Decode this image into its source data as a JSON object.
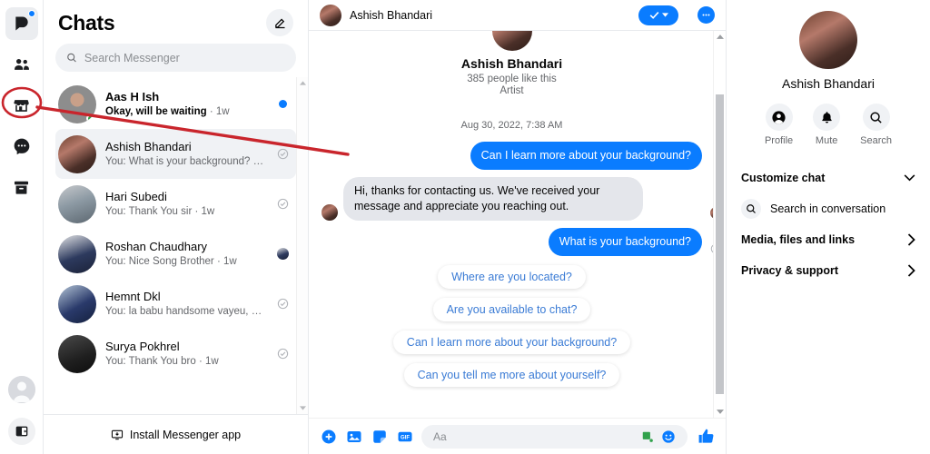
{
  "rail": {
    "items": [
      {
        "name": "facebook-home-icon",
        "label": "Facebook",
        "active": true,
        "badge": true
      },
      {
        "name": "friends-icon",
        "label": "Friends",
        "active": false,
        "badge": false
      },
      {
        "name": "marketplace-icon",
        "label": "Marketplace",
        "active": false,
        "badge": false
      },
      {
        "name": "messenger-chats-icon",
        "label": "Chats",
        "active": false,
        "badge": false
      },
      {
        "name": "archive-icon",
        "label": "Archived",
        "active": false,
        "badge": false
      }
    ],
    "bottom": [
      {
        "name": "profile-avatar",
        "label": "Profile"
      },
      {
        "name": "panel-toggle-icon",
        "label": "Toggle panel"
      }
    ]
  },
  "chat_list": {
    "title": "Chats",
    "compose_label": "New message",
    "search": {
      "placeholder": "Search Messenger",
      "value": ""
    },
    "rows": [
      {
        "name": "Aas H Ish",
        "snippet": "Okay, will be waiting",
        "time": "1w",
        "unread": true,
        "online": true,
        "status": "unread-dot",
        "avatar": "p1",
        "selected": false
      },
      {
        "name": "Ashish Bhandari",
        "snippet": "You: What is your background?",
        "time": "1w",
        "unread": false,
        "online": false,
        "status": "sent-check",
        "avatar": "p2",
        "selected": true
      },
      {
        "name": "Hari Subedi",
        "snippet": "You: Thank You sir",
        "time": "1w",
        "unread": false,
        "online": false,
        "status": "sent-check",
        "avatar": "p3",
        "selected": false
      },
      {
        "name": "Roshan Chaudhary",
        "snippet": "You: Nice Song Brother",
        "time": "1w",
        "unread": false,
        "online": false,
        "status": "seen-avatar",
        "avatar": "p4",
        "selected": false
      },
      {
        "name": "Hemnt Dkl",
        "snippet": "You: la babu handsome vayeu, ch...",
        "time": "1w",
        "unread": false,
        "online": false,
        "status": "sent-check",
        "avatar": "p5",
        "selected": false
      },
      {
        "name": "Surya Pokhrel",
        "snippet": "You: Thank You bro",
        "time": "1w",
        "unread": false,
        "online": false,
        "status": "sent-check",
        "avatar": "p6",
        "selected": false
      }
    ],
    "footer_label": "Install Messenger app"
  },
  "conversation": {
    "header": {
      "name": "Ashish Bhandari",
      "mark_done_label": "Mark as done",
      "more_label": "More options"
    },
    "intro": {
      "name": "Ashish Bhandari",
      "likes": "385 people like this",
      "category": "Artist"
    },
    "timestamp": "Aug 30, 2022, 7:38 AM",
    "messages": [
      {
        "direction": "out",
        "text": "Can I learn more about your background?",
        "status": ""
      },
      {
        "direction": "in",
        "text": "Hi, thanks for contacting us. We've received your message and appreciate you reaching out.",
        "status": "seen-avatar"
      },
      {
        "direction": "out",
        "text": "What is your background?",
        "status": "delivered-check"
      }
    ],
    "suggestions": [
      "Where are you located?",
      "Are you available to chat?",
      "Can I learn more about your background?",
      "Can you tell me more about yourself?"
    ],
    "composer": {
      "placeholder": "Aa",
      "value": "",
      "icons": [
        "plus-circle-icon",
        "photo-icon",
        "sticker-icon",
        "gif-icon"
      ],
      "right_icons": [
        "game-icon",
        "emoji-icon",
        "thumbs-up-icon"
      ]
    }
  },
  "right_panel": {
    "name": "Ashish Bhandari",
    "actions": [
      {
        "icon": "profile-icon",
        "label": "Profile"
      },
      {
        "icon": "bell-icon",
        "label": "Mute"
      },
      {
        "icon": "search-icon",
        "label": "Search"
      }
    ],
    "items": [
      {
        "label": "Customize chat",
        "chevron": "down",
        "name": "customize-chat"
      },
      {
        "label": "Search in conversation",
        "chevron": "none",
        "name": "search-in-conversation"
      },
      {
        "label": "Media, files and links",
        "chevron": "right",
        "name": "media-files-links"
      },
      {
        "label": "Privacy & support",
        "chevron": "right",
        "name": "privacy-support"
      }
    ]
  },
  "annotation": {
    "color": "#c9252c",
    "shape": "ellipse-with-arrow",
    "target": "messenger-chats-icon"
  },
  "colors": {
    "accent_blue": "#0a7cff",
    "bubble_in": "#e4e6eb",
    "text_primary": "#050505",
    "text_secondary": "#65676b",
    "annotation_red": "#c9252c"
  }
}
